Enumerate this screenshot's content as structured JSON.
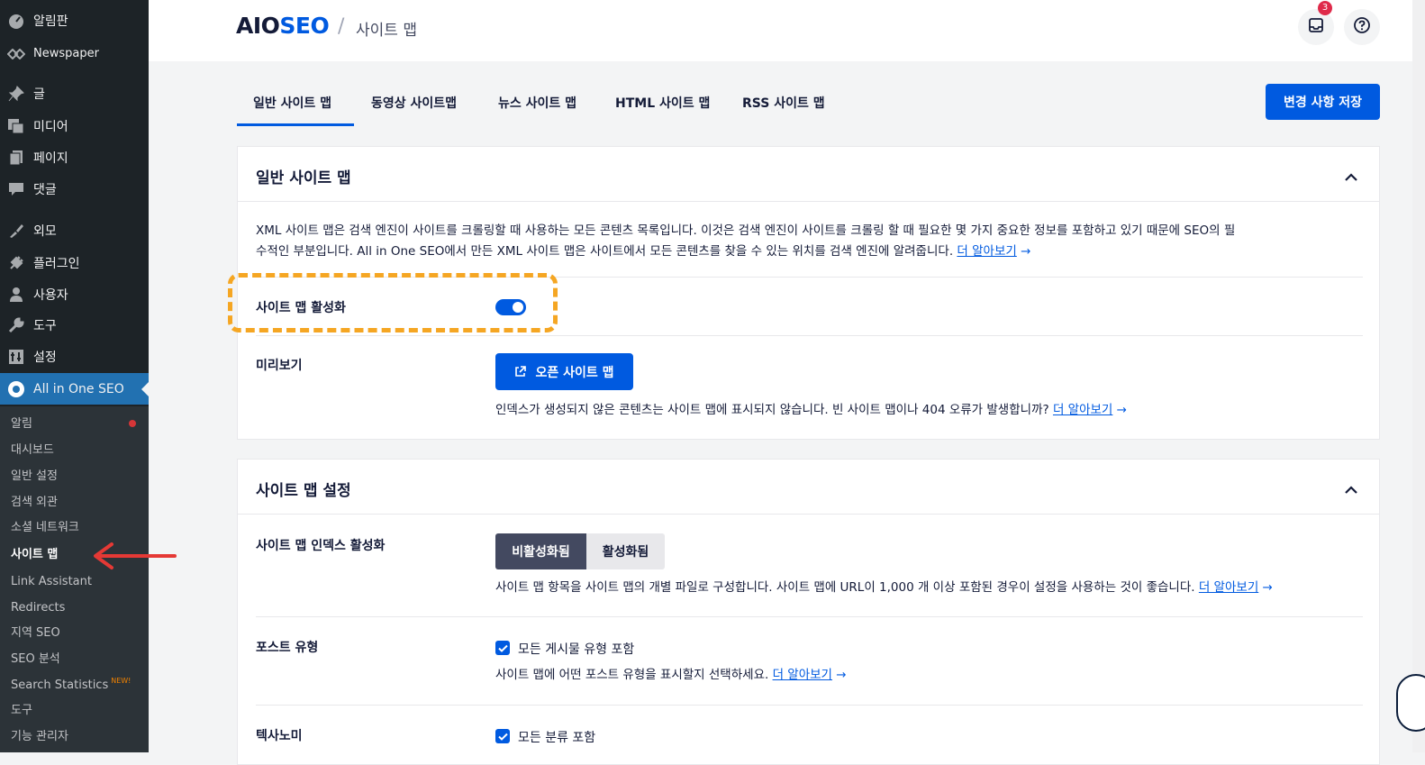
{
  "sidebar": {
    "items": [
      {
        "label": "알림판",
        "icon": "dashboard-icon"
      },
      {
        "label": "Newspaper",
        "icon": "newspaper-icon"
      },
      {
        "label": "글",
        "icon": "pin-icon"
      },
      {
        "label": "미디어",
        "icon": "media-icon"
      },
      {
        "label": "페이지",
        "icon": "pages-icon"
      },
      {
        "label": "댓글",
        "icon": "comments-icon"
      },
      {
        "label": "외모",
        "icon": "appearance-icon"
      },
      {
        "label": "플러그인",
        "icon": "plugins-icon"
      },
      {
        "label": "사용자",
        "icon": "users-icon"
      },
      {
        "label": "도구",
        "icon": "tools-icon"
      },
      {
        "label": "설정",
        "icon": "settings-icon"
      },
      {
        "label": "All in One SEO",
        "icon": "aioseo-icon"
      }
    ],
    "submenu": [
      "알림",
      "대시보드",
      "일반 설정",
      "검색 외관",
      "소셜 네트워크",
      "사이트 맵",
      "Link Assistant",
      "Redirects",
      "지역 SEO",
      "SEO 분석",
      "Search Statistics",
      "도구",
      "기능 관리자"
    ],
    "new_tag": "NEW!"
  },
  "header": {
    "logo_aio": "AIO",
    "logo_seo": "SEO",
    "separator": "/",
    "breadcrumb": "사이트 맵",
    "notification_count": "3"
  },
  "tabs": [
    "일반 사이트 맵",
    "동영상 사이트맵",
    "뉴스 사이트 맵",
    "HTML 사이트 맵",
    "RSS 사이트 맵"
  ],
  "save_button": "변경 사항 저장",
  "general_card": {
    "title": "일반 사이트 맵",
    "desc_line1": "XML 사이트 맵은 검색 엔진이 사이트를 크롤링할 때 사용하는 모든 콘텐츠 목록입니다. 이것은 검색 엔진이 사이트를 크롤링 할 때 필요한 몇 가지 중요한 정보를 포함하고 있기 때문에 SEO의 필",
    "desc_line2": "수적인 부분입니다. All in One SEO에서 만든 XML 사이트 맵은 사이트에서 모든 콘텐츠를 찾을 수 있는 위치를 검색 엔진에 알려줍니다.",
    "learn_more": "더 알아보기",
    "arrow": "→",
    "enable_label": "사이트 맵 활성화",
    "preview_label": "미리보기",
    "open_button": "오픈 사이트 맵",
    "preview_note": "인덱스가 생성되지 않은 콘텐츠는 사이트 맵에 표시되지 않습니다. 빈 사이트 맵이나 404 오류가 발생합니까?"
  },
  "settings_card": {
    "title": "사이트 맵 설정",
    "index_label": "사이트 맵 인덱스 활성화",
    "seg_off": "비활성화됨",
    "seg_on": "활성화됨",
    "index_note": "사이트 맵 항목을 사이트 맵의 개별 파일로 구성합니다. 사이트 맵에 URL이 1,000 개 이상 포함된 경우이 설정을 사용하는 것이 좋습니다.",
    "post_type_label": "포스트 유형",
    "post_type_check": "모든 게시물 유형 포함",
    "post_type_note": "사이트 맵에 어떤 포스트 유형을 표시할지 선택하세요.",
    "taxonomy_label": "텍사노미",
    "taxonomy_check": "모든 분류 포함"
  },
  "colors": {
    "accent": "#005ae0",
    "highlight": "#f5a623",
    "sidebar": "#1d2327",
    "active": "#2271b1"
  }
}
